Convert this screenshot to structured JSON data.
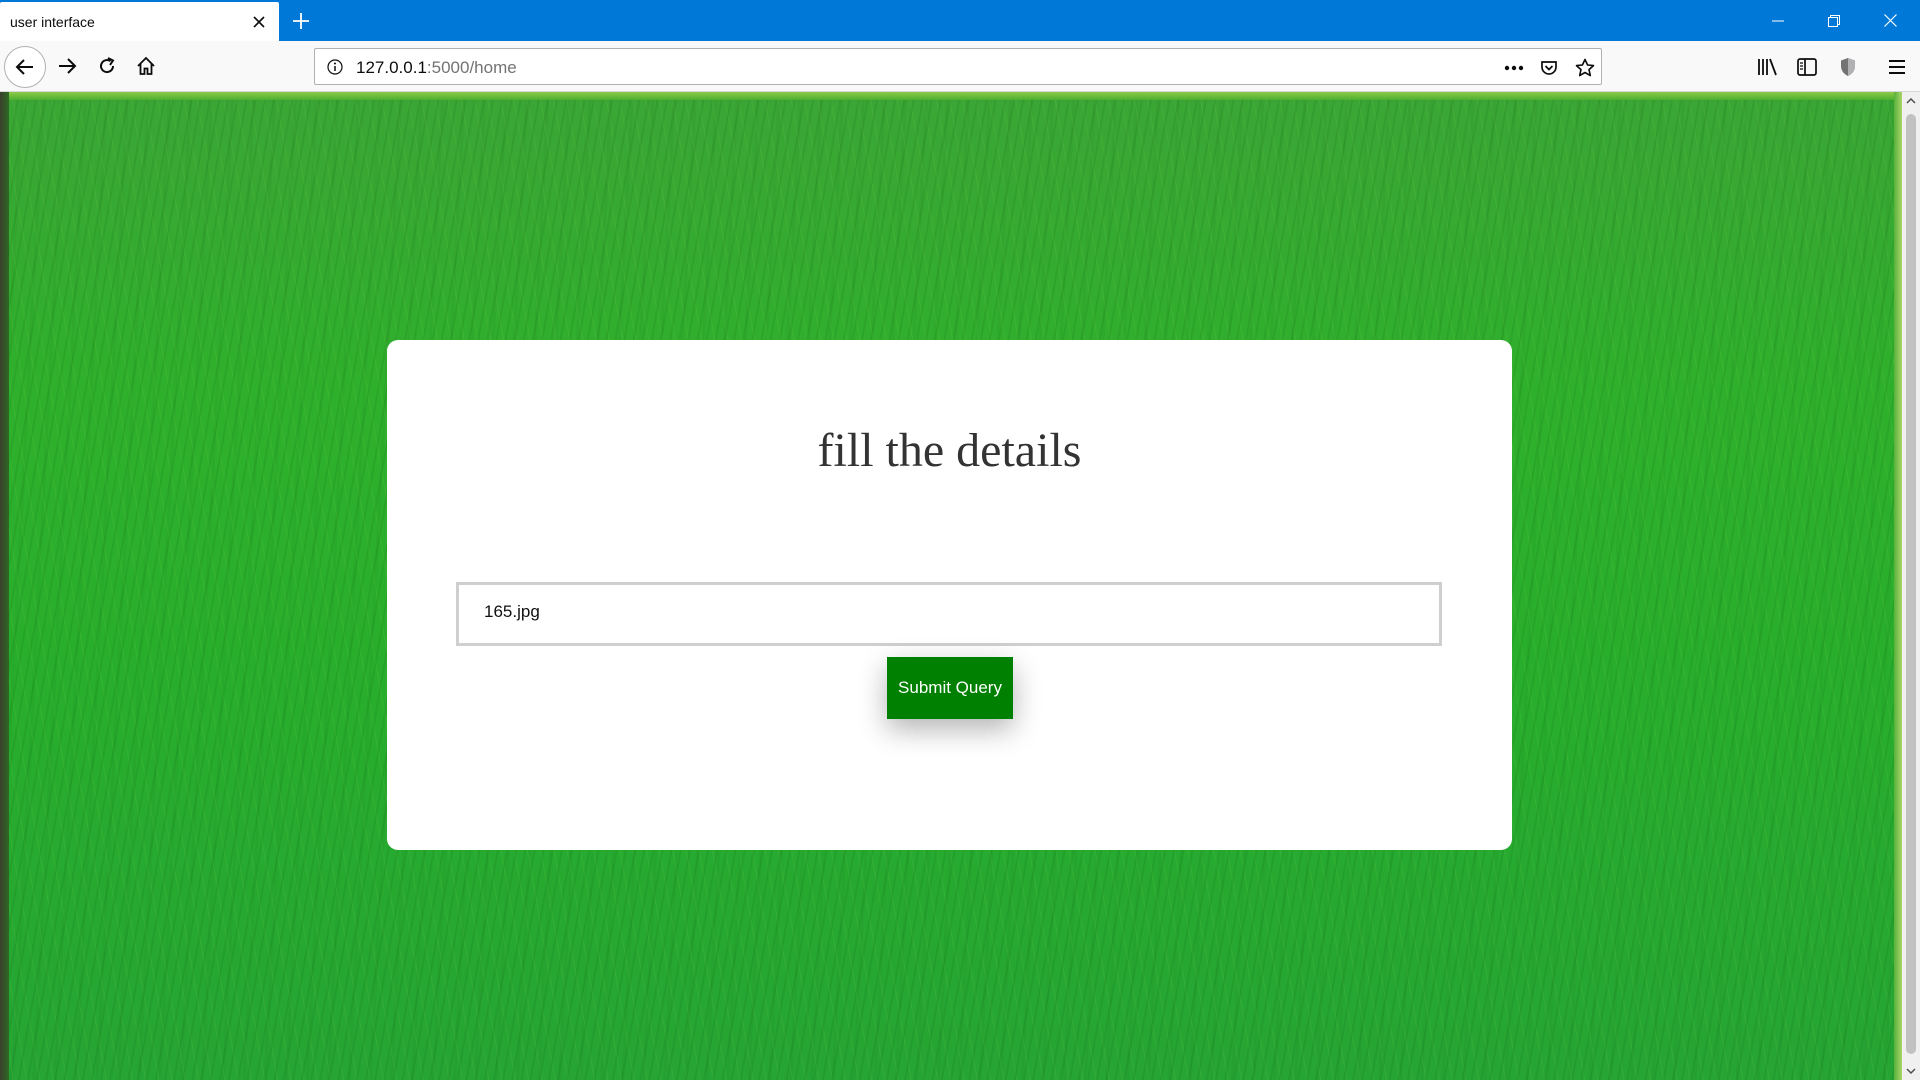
{
  "browser": {
    "tab_title": "user interface",
    "url_host": "127.0.0.1",
    "url_path": ":5000/home"
  },
  "page": {
    "heading": "fill the details",
    "file_value": "165.jpg",
    "submit_label": "Submit Query"
  },
  "colors": {
    "titlebar": "#0078d7",
    "submit_button": "#008000",
    "background_grass": "#2fb02c"
  }
}
